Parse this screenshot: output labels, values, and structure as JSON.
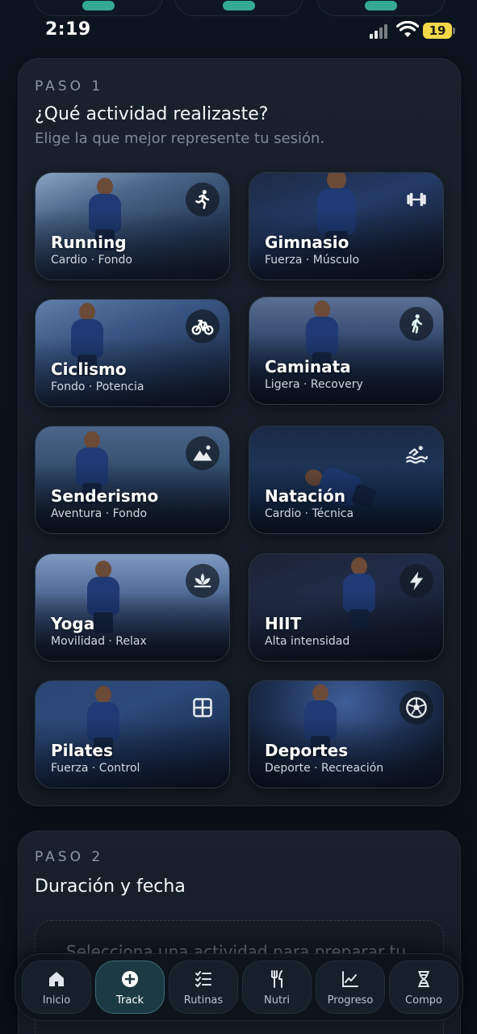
{
  "status_bar": {
    "time": "2:19",
    "battery": "19"
  },
  "step1": {
    "label": "PASO 1",
    "title": "¿Qué actividad realizaste?",
    "subtitle": "Elige la que mejor represente tu sesión.",
    "activities": [
      {
        "name": "Running",
        "tags": "Cardio · Fondo",
        "icon": "running-icon"
      },
      {
        "name": "Gimnasio",
        "tags": "Fuerza · Músculo",
        "icon": "dumbbell-icon"
      },
      {
        "name": "Ciclismo",
        "tags": "Fondo · Potencia",
        "icon": "bicycle-icon"
      },
      {
        "name": "Caminata",
        "tags": "Ligera · Recovery",
        "icon": "walking-icon"
      },
      {
        "name": "Senderismo",
        "tags": "Aventura · Fondo",
        "icon": "mountain-icon"
      },
      {
        "name": "Natación",
        "tags": "Cardio · Técnica",
        "icon": "swimming-icon"
      },
      {
        "name": "Yoga",
        "tags": "Movilidad · Relax",
        "icon": "lotus-icon"
      },
      {
        "name": "HIIT",
        "tags": "Alta intensidad",
        "icon": "lightning-icon"
      },
      {
        "name": "Pilates",
        "tags": "Fuerza · Control",
        "icon": "grid-icon"
      },
      {
        "name": "Deportes",
        "tags": "Deporte · Recreación",
        "icon": "soccer-ball-icon"
      }
    ]
  },
  "step2": {
    "label": "PASO 2",
    "title": "Duración y fecha",
    "placeholder": "Selecciona una actividad para preparar tu"
  },
  "nav": {
    "items": [
      {
        "label": "Inicio",
        "icon": "home-icon"
      },
      {
        "label": "Track",
        "icon": "plus-circle-icon",
        "active": true
      },
      {
        "label": "Rutinas",
        "icon": "checklist-icon"
      },
      {
        "label": "Nutri",
        "icon": "fork-knife-icon"
      },
      {
        "label": "Progreso",
        "icon": "chart-line-icon"
      },
      {
        "label": "Compo",
        "icon": "dna-icon"
      }
    ]
  },
  "colors": {
    "background": "#0a121c",
    "card": "#161f2a",
    "accent": "#3ecfb0",
    "active_nav": "#1d3a44"
  }
}
